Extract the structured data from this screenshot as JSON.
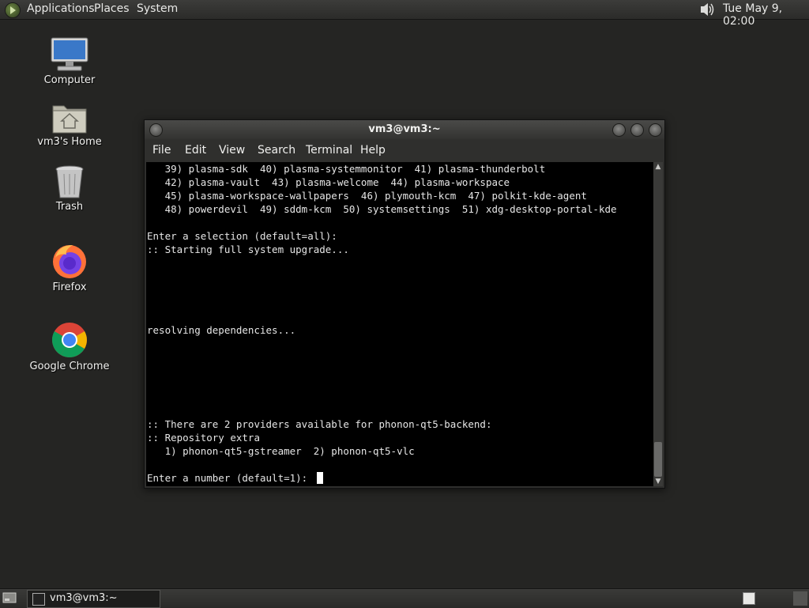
{
  "top_panel": {
    "menus": [
      "Applications",
      "Places",
      "System"
    ],
    "clock": "Tue May  9, 02:00",
    "icons": [
      "distro-menu-icon",
      "speaker-icon"
    ]
  },
  "desktop_icons": [
    {
      "label": "Computer",
      "icon": "computer-icon"
    },
    {
      "label": "vm3's Home",
      "icon": "home-folder-icon"
    },
    {
      "label": "Trash",
      "icon": "trash-icon"
    },
    {
      "label": "Firefox",
      "icon": "firefox-icon"
    },
    {
      "label": "Google Chrome",
      "icon": "chrome-icon"
    }
  ],
  "terminal": {
    "title": "vm3@vm3:~",
    "menu": [
      "File",
      "Edit",
      "View",
      "Search",
      "Terminal",
      "Help"
    ],
    "lines": [
      "   39) plasma-sdk  40) plasma-systemmonitor  41) plasma-thunderbolt",
      "   42) plasma-vault  43) plasma-welcome  44) plasma-workspace",
      "   45) plasma-workspace-wallpapers  46) plymouth-kcm  47) polkit-kde-agent",
      "   48) powerdevil  49) sddm-kcm  50) systemsettings  51) xdg-desktop-portal-kde",
      "",
      "Enter a selection (default=all):",
      ":: Starting full system upgrade...",
      "",
      "",
      "",
      "",
      "",
      "resolving dependencies...",
      "",
      "",
      "",
      "",
      "",
      "",
      ":: There are 2 providers available for phonon-qt5-backend:",
      ":: Repository extra",
      "   1) phonon-qt5-gstreamer  2) phonon-qt5-vlc",
      "",
      "Enter a number (default=1): "
    ]
  },
  "taskbar": {
    "task_label": "vm3@vm3:~"
  },
  "colors": {
    "desktop": "#252523",
    "terminal_bg": "#000000",
    "terminal_fg": "#e6e6e6"
  }
}
